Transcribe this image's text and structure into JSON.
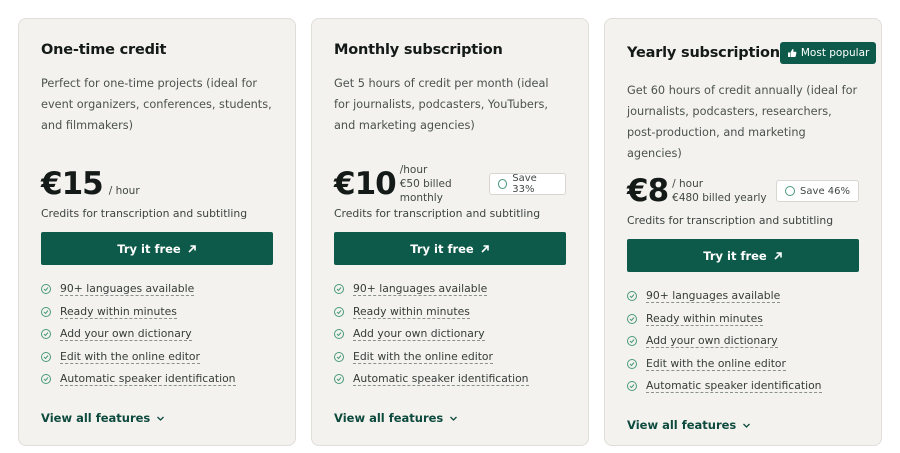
{
  "cards": [
    {
      "title": "One-time credit",
      "description": "Perfect for one-time projects (ideal for event organizers, conferences, students, and filmmakers)",
      "price": "€15",
      "period": "/ hour",
      "credits_note": "Credits for transcription and subtitling",
      "cta_label": "Try it free",
      "features": [
        "90+ languages available",
        "Ready within minutes",
        "Add your own dictionary",
        "Edit with the online editor",
        "Automatic speaker identification"
      ],
      "view_all_label": "View all features"
    },
    {
      "title": "Monthly subscription",
      "description": "Get 5 hours of credit per month (ideal for journalists, podcasters, YouTubers, and marketing agencies)",
      "price": "€10",
      "period": "/hour",
      "billing": "€50 billed monthly",
      "save_label": "Save 33%",
      "credits_note": "Credits for transcription and subtitling",
      "cta_label": "Try it free",
      "features": [
        "90+ languages available",
        "Ready within minutes",
        "Add your own dictionary",
        "Edit with the online editor",
        "Automatic speaker identification"
      ],
      "view_all_label": "View all features"
    },
    {
      "title": "Yearly subscription",
      "badge": "Most popular",
      "description": "Get 60 hours of credit annually (ideal for journalists, podcasters, researchers, post-production, and marketing agencies)",
      "price": "€8",
      "period": "/ hour",
      "billing": "€480 billed yearly",
      "save_label": "Save 46%",
      "credits_note": "Credits for transcription and subtitling",
      "cta_label": "Try it free",
      "features": [
        "90+ languages available",
        "Ready within minutes",
        "Add your own dictionary",
        "Edit with the online editor",
        "Automatic speaker identification"
      ],
      "view_all_label": "View all features"
    }
  ],
  "icons": {
    "arrow": "arrow-up-right-icon",
    "check": "check-circle-icon",
    "chevron": "chevron-down-icon",
    "thumb": "thumbs-up-icon",
    "coin": "coin-icon"
  },
  "colors": {
    "brand": "#0d5a4a",
    "card_bg": "#f4f2ef",
    "accent_green": "#4a9a7c"
  }
}
